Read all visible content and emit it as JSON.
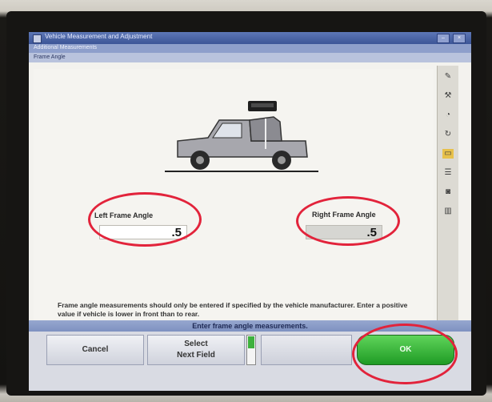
{
  "window": {
    "title": "Vehicle Measurement and Adjustment",
    "subtitle": "Additional Measurements",
    "page_label": "Frame Angle"
  },
  "screen": {
    "left_label": "Left Frame Angle",
    "left_value": ".5",
    "right_label": "Right Frame Angle",
    "right_value": ".5",
    "instructions": "Frame angle measurements should only be entered if specified by the vehicle manufacturer.  Enter a positive value if vehicle is lower in front than to rear.",
    "status": "Enter frame angle measurements."
  },
  "buttons": {
    "cancel": "Cancel",
    "select_line1": "Select",
    "select_line2": "Next Field",
    "ok": "OK"
  },
  "colors": {
    "title_bar": "#3c5597",
    "ok_green": "#1f9b25",
    "highlight_ring": "#e2233b"
  },
  "icons": [
    "edit-icon",
    "wrench-icon",
    "gauge-icon",
    "refresh-icon",
    "folder-icon",
    "list-icon",
    "camera-icon",
    "chart-icon"
  ]
}
